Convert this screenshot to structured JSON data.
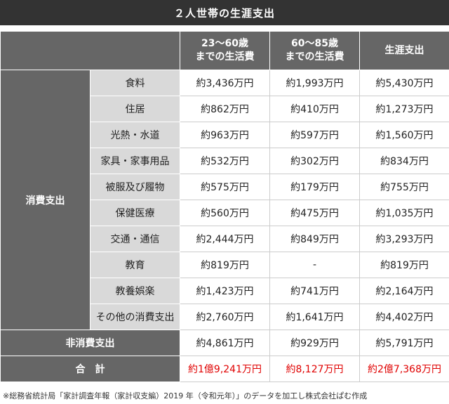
{
  "title": "２人世帯の生涯支出",
  "headers": {
    "col1_line1": "23～60歳",
    "col1_line2": "までの生活費",
    "col2_line1": "60～85歳",
    "col2_line2": "までの生活費",
    "col3": "生涯支出"
  },
  "consumption_label": "消費支出",
  "rows": [
    {
      "label": "食料",
      "a": "約3,436万円",
      "b": "約1,993万円",
      "c": "約5,430万円"
    },
    {
      "label": "住居",
      "a": "約862万円",
      "b": "約410万円",
      "c": "約1,273万円"
    },
    {
      "label": "光熱・水道",
      "a": "約963万円",
      "b": "約597万円",
      "c": "約1,560万円"
    },
    {
      "label": "家具・家事用品",
      "a": "約532万円",
      "b": "約302万円",
      "c": "約834万円"
    },
    {
      "label": "被服及び履物",
      "a": "約575万円",
      "b": "約179万円",
      "c": "約755万円"
    },
    {
      "label": "保健医療",
      "a": "約560万円",
      "b": "約475万円",
      "c": "約1,035万円"
    },
    {
      "label": "交通・通信",
      "a": "約2,444万円",
      "b": "約849万円",
      "c": "約3,293万円"
    },
    {
      "label": "教育",
      "a": "約819万円",
      "b": "-",
      "c": "約819万円"
    },
    {
      "label": "教養娯楽",
      "a": "約1,423万円",
      "b": "約741万円",
      "c": "約2,164万円"
    },
    {
      "label": "その他の消費支出",
      "a": "約2,760万円",
      "b": "約1,641万円",
      "c": "約4,402万円"
    }
  ],
  "non_consumption": {
    "label": "非消費支出",
    "a": "約4,861万円",
    "b": "約929万円",
    "c": "約5,791万円"
  },
  "total": {
    "label": "合　計",
    "a": "約1億9,241万円",
    "b": "約8,127万円",
    "c": "約2億7,368万円"
  },
  "note": "※総務省統計局「家計調査年報（家計収支編）2019 年（令和元年）」のデータを加工し株式会社ぱむ作成",
  "colors": {
    "header_bg": "#666666",
    "title_bg": "#333333",
    "label_bg": "#d9d9d9",
    "total_text": "#e00000"
  }
}
